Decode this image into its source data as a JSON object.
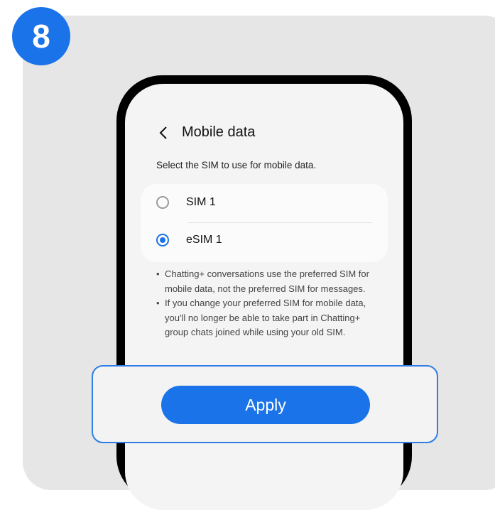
{
  "step": {
    "number": "8"
  },
  "screen": {
    "title": "Mobile data",
    "subtitle": "Select the SIM to use for mobile data."
  },
  "sim_options": [
    {
      "label": "SIM 1",
      "selected": false
    },
    {
      "label": "eSIM 1",
      "selected": true
    }
  ],
  "notes": [
    "Chatting+ conversations use the preferred SIM for mobile data, not the preferred SIM for messages.",
    "If you change your preferred SIM for mobile data, you'll no longer be able to take part in Chatting+ group chats joined while using your old SIM."
  ],
  "apply_button": {
    "label": "Apply"
  },
  "icons": {
    "back": "chevron-left-icon"
  },
  "colors": {
    "accent": "#1a73e8",
    "callout_border": "#2e7de6"
  }
}
